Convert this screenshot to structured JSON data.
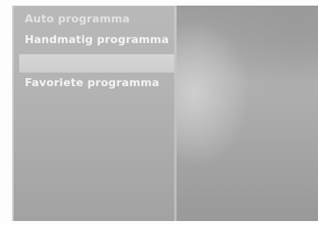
{
  "menu": {
    "items": [
      {
        "label": "Auto programma"
      },
      {
        "label": "Handmatig programma"
      },
      {
        "label": ""
      },
      {
        "label": "Favoriete programma"
      }
    ]
  }
}
